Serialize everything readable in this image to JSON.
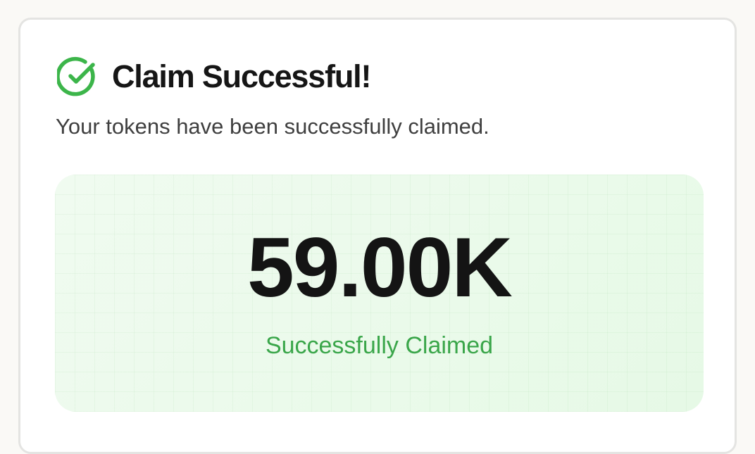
{
  "dialog": {
    "title": "Claim Successful!",
    "subtitle": "Your tokens have been successfully claimed.",
    "icon": "check-circle-icon",
    "accent_color": "#3cb54a"
  },
  "claim": {
    "amount": "59.00K",
    "status_label": "Successfully Claimed"
  }
}
